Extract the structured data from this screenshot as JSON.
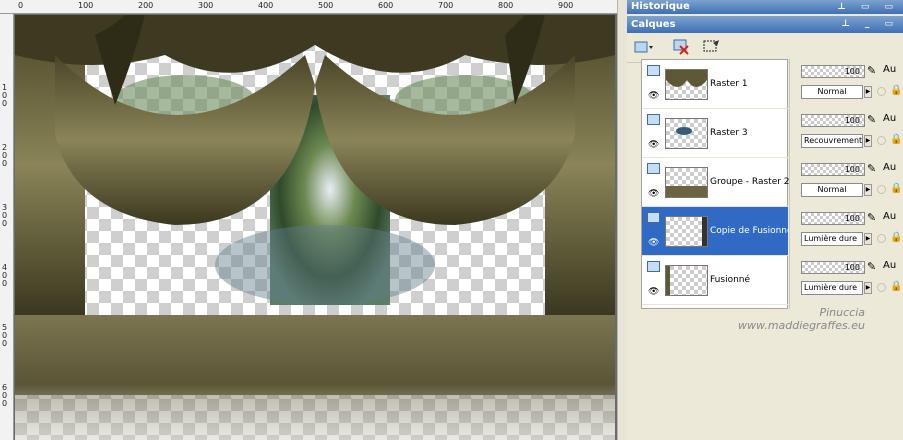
{
  "ruler": {
    "h_ticks": [
      "0",
      "100",
      "200",
      "300",
      "400",
      "500",
      "600",
      "700",
      "800",
      "900"
    ],
    "v_ticks": [
      "1\n0\n0",
      "2\n0\n0",
      "3\n0\n0",
      "4\n0\n0",
      "5\n0\n0",
      "6\n0\n0"
    ]
  },
  "panels": {
    "history_title": "Historique",
    "layers_title": "Calques",
    "title_buttons": "⊥ ▭ ▭",
    "layers_title_buttons": "⊥ _ ▭"
  },
  "layers": [
    {
      "name": "Raster 1",
      "opacity": "100",
      "blend": "Normal",
      "au": "Au"
    },
    {
      "name": "Raster 3",
      "opacity": "100",
      "blend": "Recouvrement",
      "au": "Au"
    },
    {
      "name": "Groupe - Raster 2",
      "opacity": "100",
      "blend": "Normal",
      "au": "Au"
    },
    {
      "name": "Copie de Fusionné",
      "opacity": "100",
      "blend": "Lumière dure",
      "au": "Au"
    },
    {
      "name": "Fusionné",
      "opacity": "100",
      "blend": "Lumière dure",
      "au": "Au"
    }
  ],
  "watermark": {
    "line1": "Pinuccia",
    "line2": "www.maddiegraffes.eu"
  },
  "icons": {
    "eye": "eye-icon",
    "lock": "lock-icon",
    "brush": "brush-icon"
  }
}
